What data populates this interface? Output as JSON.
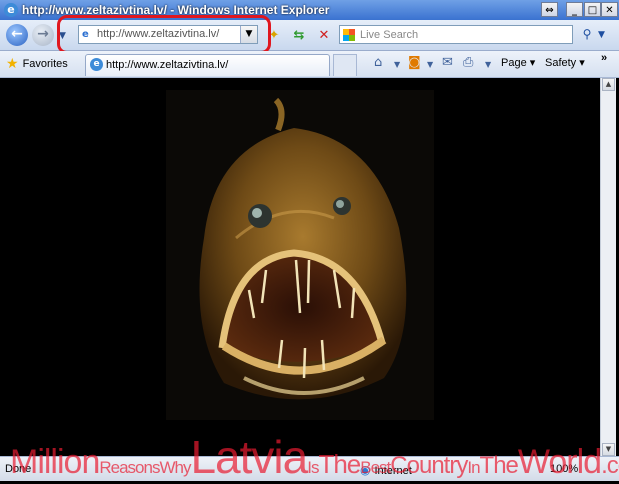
{
  "window": {
    "title": "http://www.zeltazivtina.lv/ - Windows Internet Explorer",
    "controls": [
      "⇔",
      "_",
      "□",
      "✕"
    ]
  },
  "nav": {
    "back_glyph": "←",
    "forward_glyph": "→",
    "address_url": "http://www.zeltazivtina.lv/",
    "search_placeholder": "Live Search"
  },
  "tabbar": {
    "favorites_label": "Favorites",
    "tab_title": "http://www.zeltazivtina.lv/",
    "page_menu": "Page",
    "safety_menu": "Safety"
  },
  "status": {
    "text": "Done",
    "zone": "Internet",
    "zoom": "100%"
  },
  "watermark": {
    "w1": "Million",
    "w2": "Reasons",
    "w3": "Why",
    "w4": "Latvia",
    "w5": "Is",
    "w6": "The",
    "w7": "Best",
    "w8": "Country",
    "w9": "In",
    "w10": "The",
    "w11": "World",
    "w12": ".com"
  },
  "colors": {
    "highlight_circle": "#e0171f",
    "watermark": "#e81b30",
    "titlebar": "#3a72d0"
  }
}
